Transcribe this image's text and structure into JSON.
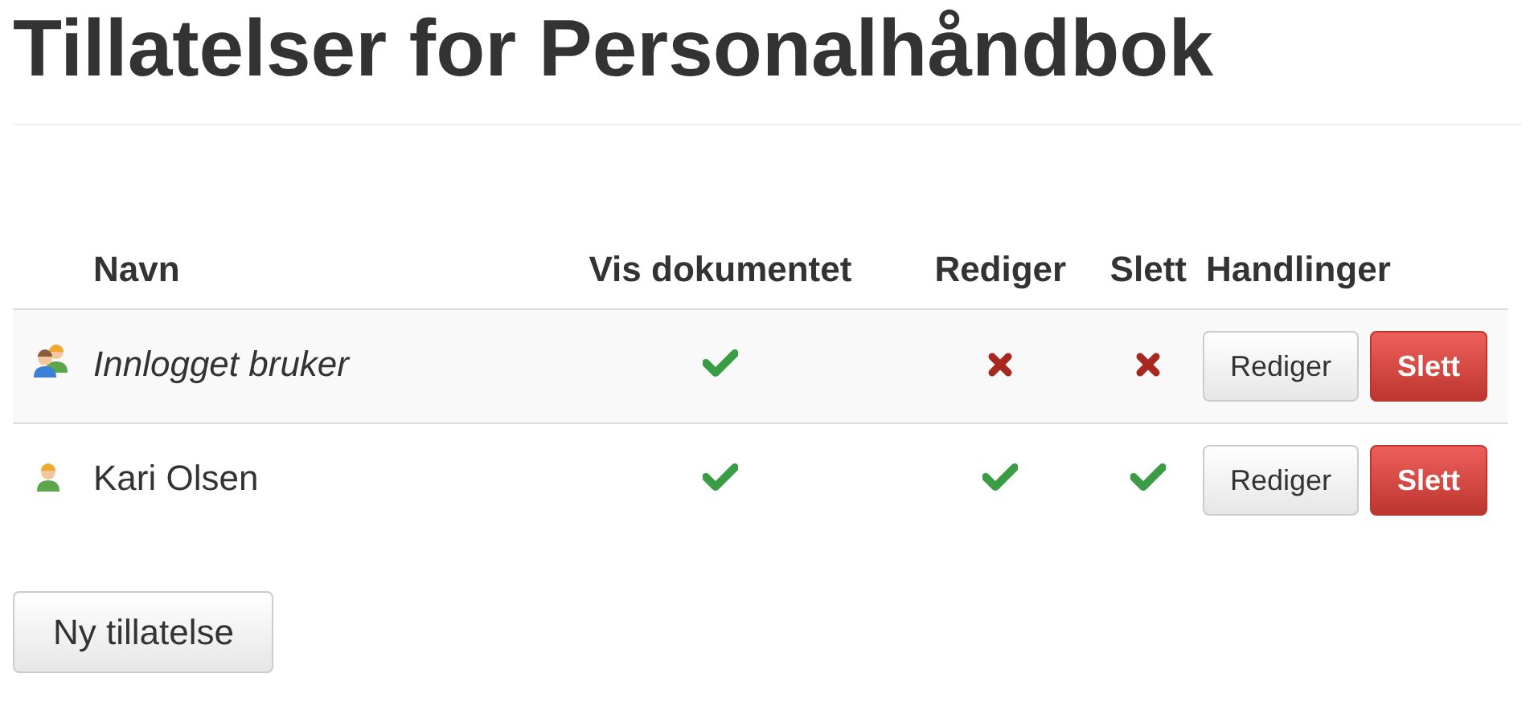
{
  "title": "Tillatelser for Personalhåndbok",
  "table": {
    "columns": [
      "Navn",
      "Vis dokumentet",
      "Rediger",
      "Slett",
      "Handlinger"
    ],
    "rows": [
      {
        "kind": "group",
        "name": "Innlogget bruker",
        "view": true,
        "edit": false,
        "delete": false,
        "actions": [
          "Rediger",
          "Slett"
        ]
      },
      {
        "kind": "user",
        "name": "Kari Olsen",
        "view": true,
        "edit": true,
        "delete": true,
        "actions": [
          "Rediger",
          "Slett"
        ]
      }
    ]
  },
  "new_button": "Ny tillatelse"
}
